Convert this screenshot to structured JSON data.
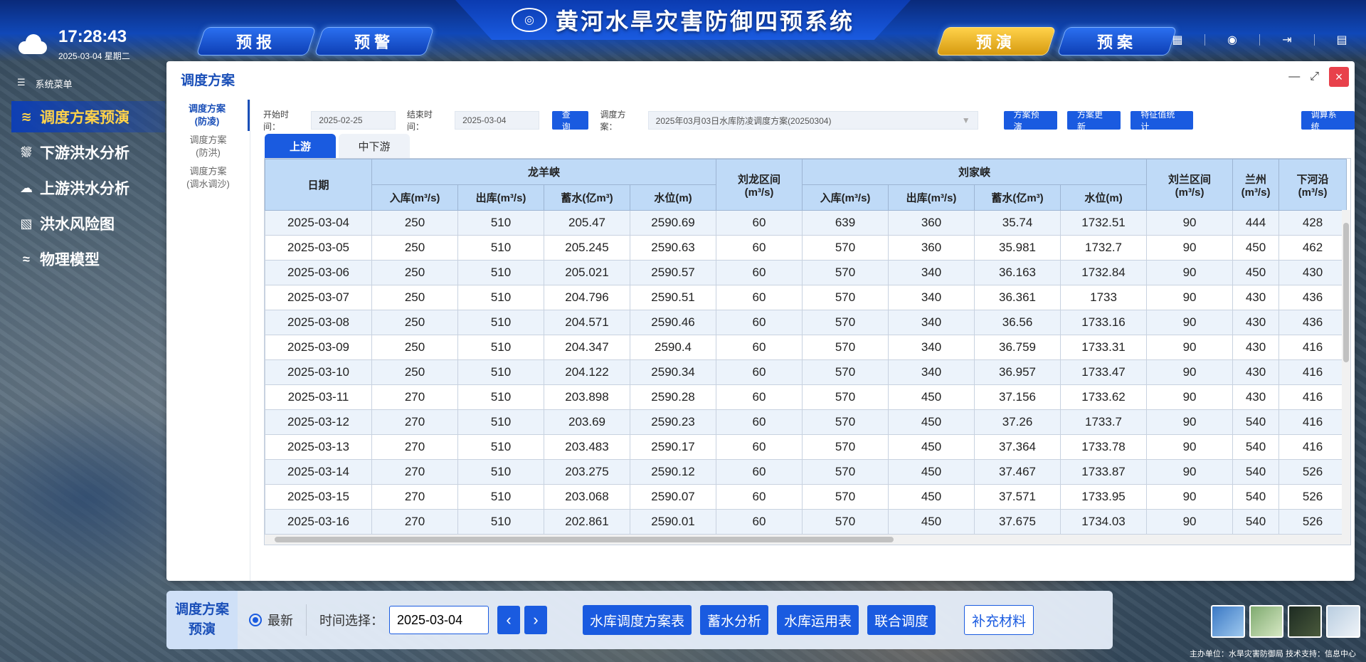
{
  "header": {
    "title": "黄河水旱灾害防御四预系统",
    "nav": [
      "预报",
      "预警",
      "预演",
      "预案"
    ],
    "active_nav": "预演"
  },
  "clock": {
    "time": "17:28:43",
    "date": "2025-03-04 星期二"
  },
  "menu": {
    "head": "系统菜单",
    "items": [
      {
        "label": "调度方案预演",
        "icon": "dispatch-icon"
      },
      {
        "label": "下游洪水分析",
        "icon": "downstream-icon"
      },
      {
        "label": "上游洪水分析",
        "icon": "upstream-icon"
      },
      {
        "label": "洪水风险图",
        "icon": "risk-map-icon"
      },
      {
        "label": "物理模型",
        "icon": "model-icon"
      }
    ]
  },
  "panel": {
    "title": "调度方案",
    "subnav": [
      {
        "l1": "调度方案",
        "l2": "(防凌)"
      },
      {
        "l1": "调度方案",
        "l2": "(防洪)"
      },
      {
        "l1": "调度方案",
        "l2": "(调水调沙)"
      }
    ],
    "filter": {
      "start_label": "开始时间：",
      "start_value": "2025-02-25",
      "end_label": "结束时间：",
      "end_value": "2025-03-04",
      "query": "查询",
      "plan_label": "调度方案：",
      "plan_value": "2025年03月03日水库防凌调度方案(20250304)",
      "btn_preview": "方案预演",
      "btn_update": "方案更新",
      "btn_stats": "特征值统计",
      "btn_calc": "调算系统"
    },
    "tabs": [
      "上游",
      "中下游"
    ],
    "headers": {
      "date": "日期",
      "g1": "龙羊峡",
      "g2": "刘家峡",
      "inflow": "入库(m³/s)",
      "outflow": "出库(m³/s)",
      "storage": "蓄水(亿m³)",
      "level": "水位(m)",
      "liulong_1": "刘龙区间",
      "liulong_2": "(m³/s)",
      "liulan_1": "刘兰区间",
      "liulan_2": "(m³/s)",
      "lanzhou_1": "兰州",
      "lanzhou_2": "(m³/s)",
      "xiaheyan_1": "下河沿",
      "xiaheyan_2": "(m³/s)"
    },
    "rows": [
      [
        "2025-03-04",
        "250",
        "510",
        "205.47",
        "2590.69",
        "60",
        "639",
        "360",
        "35.74",
        "1732.51",
        "90",
        "444",
        "428"
      ],
      [
        "2025-03-05",
        "250",
        "510",
        "205.245",
        "2590.63",
        "60",
        "570",
        "360",
        "35.981",
        "1732.7",
        "90",
        "450",
        "462"
      ],
      [
        "2025-03-06",
        "250",
        "510",
        "205.021",
        "2590.57",
        "60",
        "570",
        "340",
        "36.163",
        "1732.84",
        "90",
        "450",
        "430"
      ],
      [
        "2025-03-07",
        "250",
        "510",
        "204.796",
        "2590.51",
        "60",
        "570",
        "340",
        "36.361",
        "1733",
        "90",
        "430",
        "436"
      ],
      [
        "2025-03-08",
        "250",
        "510",
        "204.571",
        "2590.46",
        "60",
        "570",
        "340",
        "36.56",
        "1733.16",
        "90",
        "430",
        "436"
      ],
      [
        "2025-03-09",
        "250",
        "510",
        "204.347",
        "2590.4",
        "60",
        "570",
        "340",
        "36.759",
        "1733.31",
        "90",
        "430",
        "416"
      ],
      [
        "2025-03-10",
        "250",
        "510",
        "204.122",
        "2590.34",
        "60",
        "570",
        "340",
        "36.957",
        "1733.47",
        "90",
        "430",
        "416"
      ],
      [
        "2025-03-11",
        "270",
        "510",
        "203.898",
        "2590.28",
        "60",
        "570",
        "450",
        "37.156",
        "1733.62",
        "90",
        "430",
        "416"
      ],
      [
        "2025-03-12",
        "270",
        "510",
        "203.69",
        "2590.23",
        "60",
        "570",
        "450",
        "37.26",
        "1733.7",
        "90",
        "540",
        "416"
      ],
      [
        "2025-03-13",
        "270",
        "510",
        "203.483",
        "2590.17",
        "60",
        "570",
        "450",
        "37.364",
        "1733.78",
        "90",
        "540",
        "416"
      ],
      [
        "2025-03-14",
        "270",
        "510",
        "203.275",
        "2590.12",
        "60",
        "570",
        "450",
        "37.467",
        "1733.87",
        "90",
        "540",
        "526"
      ],
      [
        "2025-03-15",
        "270",
        "510",
        "203.068",
        "2590.07",
        "60",
        "570",
        "450",
        "37.571",
        "1733.95",
        "90",
        "540",
        "526"
      ],
      [
        "2025-03-16",
        "270",
        "510",
        "202.861",
        "2590.01",
        "60",
        "570",
        "450",
        "37.675",
        "1734.03",
        "90",
        "540",
        "526"
      ]
    ]
  },
  "bottom": {
    "title_1": "调度方案",
    "title_2": "预演",
    "radio": "最新",
    "time_label": "时间选择：",
    "date_value": "2025-03-04",
    "buttons": [
      "水库调度方案表",
      "蓄水分析",
      "水库运用表",
      "联合调度"
    ],
    "extra": "补充材料"
  },
  "footer": "主办单位：水旱灾害防御局 技术支持：信息中心",
  "colors": {
    "primary": "#1a5be0",
    "header_blue": "#0a2a7a",
    "active_gold": "#ffd24a"
  }
}
